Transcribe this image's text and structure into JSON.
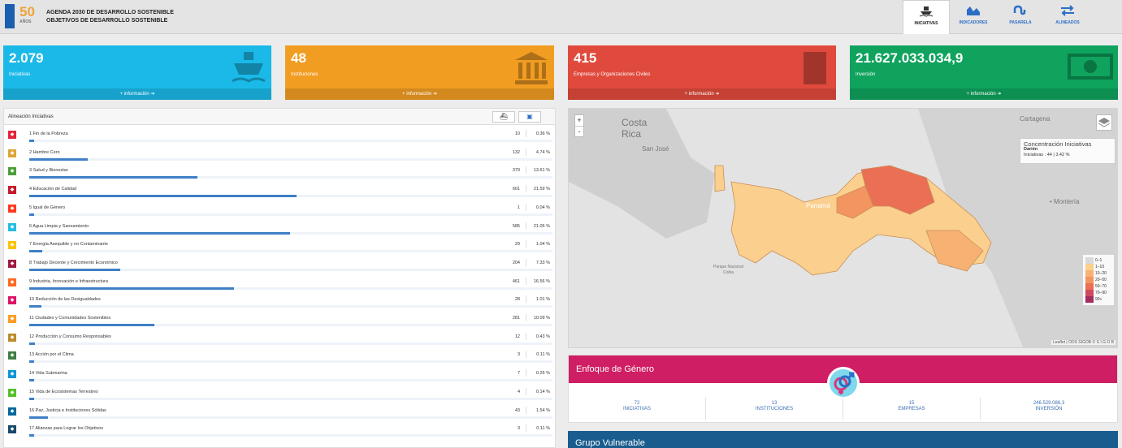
{
  "header": {
    "logo_50": "50",
    "logo_50_sub": "AÑOS",
    "title_line1": "AGENDA 2030 DE DESARROLLO SOSTENIBLE",
    "title_line2": "OBJETIVOS DE DESARROLLO SOSTENIBLE",
    "nav": [
      {
        "label": "INICIATIVAS",
        "icon": "ship-icon",
        "active": true
      },
      {
        "label": "INDICADORES",
        "icon": "area-chart-icon",
        "active": false
      },
      {
        "label": "PASARELA",
        "icon": "stumbleupon-icon",
        "active": false
      },
      {
        "label": "ALINEADOS",
        "icon": "exchange-icon",
        "active": false
      }
    ]
  },
  "cards": [
    {
      "value": "2.079",
      "label": "Iniciativas",
      "more": "+ información",
      "color": "#1ab9e8",
      "icon": "ship-icon"
    },
    {
      "value": "48",
      "label": "Instituciones",
      "more": "+ información",
      "color": "#f19d22",
      "icon": "institution-icon"
    },
    {
      "value": "415",
      "label": "Empresas y Organizaciones Civiles",
      "more": "+ información",
      "color": "#e04a3c",
      "icon": "building-icon"
    },
    {
      "value": "21.627.033.034,9",
      "label": "Inversión",
      "more": "+ información",
      "color": "#0fa35e",
      "icon": "money-icon"
    }
  ],
  "alignment": {
    "title": "Alineación Iniciativas",
    "tabs": [
      "ship-icon",
      "money-icon"
    ],
    "goals": [
      {
        "name": "1 Fin de la Pobreza",
        "count": "10",
        "pct": "0.36 %",
        "share": 0.36,
        "color": "#e5243b"
      },
      {
        "name": "2 Hambre Cero",
        "count": "132",
        "pct": "4.74 %",
        "share": 4.74,
        "color": "#dda63a"
      },
      {
        "name": "3 Salud y Bienestar",
        "count": "379",
        "pct": "13.61 %",
        "share": 13.61,
        "color": "#4c9f38"
      },
      {
        "name": "4 Educación de Calidad",
        "count": "601",
        "pct": "21.59 %",
        "share": 21.59,
        "color": "#c5192d"
      },
      {
        "name": "5 Igual de Género",
        "count": "1",
        "pct": "0.04 %",
        "share": 0.04,
        "color": "#ff3a21"
      },
      {
        "name": "6 Agua Limpia y Saneamiento",
        "count": "585",
        "pct": "21.05 %",
        "share": 21.05,
        "color": "#26bde2"
      },
      {
        "name": "7 Energía Asequible y no Contaminante",
        "count": "29",
        "pct": "1.04 %",
        "share": 1.04,
        "color": "#fcc30b"
      },
      {
        "name": "8 Trabajo Decente y Crecimiento Económico",
        "count": "204",
        "pct": "7.33 %",
        "share": 7.33,
        "color": "#a21942"
      },
      {
        "name": "9 Industria, Innovación e Infraestructura",
        "count": "461",
        "pct": "16.56 %",
        "share": 16.56,
        "color": "#fd6925"
      },
      {
        "name": "10 Reducción de las Desigualdades",
        "count": "28",
        "pct": "1.01 %",
        "share": 1.01,
        "color": "#dd1367"
      },
      {
        "name": "11 Ciudades y Comunidades Sostenibles",
        "count": "281",
        "pct": "10.09 %",
        "share": 10.09,
        "color": "#fd9d24"
      },
      {
        "name": "12 Producción y Consumo Responsables",
        "count": "12",
        "pct": "0.43 %",
        "share": 0.43,
        "color": "#bf8b2e"
      },
      {
        "name": "13 Acción por el Clima",
        "count": "3",
        "pct": "0.11 %",
        "share": 0.11,
        "color": "#3f7e44"
      },
      {
        "name": "14 Vida Submarina",
        "count": "7",
        "pct": "0.25 %",
        "share": 0.25,
        "color": "#0a97d9"
      },
      {
        "name": "15 Vida de Ecosistemas Terrestres",
        "count": "4",
        "pct": "0.14 %",
        "share": 0.14,
        "color": "#56c02b"
      },
      {
        "name": "16 Paz, Justicia e Instituciones Sólidas",
        "count": "43",
        "pct": "1.54 %",
        "share": 1.54,
        "color": "#00689d"
      },
      {
        "name": "17 Alianzas para Lograr los Objetivos",
        "count": "3",
        "pct": "0.11 %",
        "share": 0.11,
        "color": "#19486a"
      }
    ]
  },
  "map": {
    "zoom_in": "+",
    "zoom_out": "-",
    "labels": {
      "costa": "Costa",
      "rica": "Rica",
      "san_jose": "San José",
      "cartagena": "Cartagena",
      "monteria": "• Montería",
      "panama": "Panamá",
      "parque": "Parque Nacional",
      "coiba": "Coiba"
    },
    "tooltip": {
      "title": "Concentración Iniciativas",
      "region": "Darién",
      "detail": "Iniciativas : 44 | 3.42 %"
    },
    "legend": [
      {
        "label": "0–1",
        "color": "#d9d9d9"
      },
      {
        "label": "1–10",
        "color": "#fbcf8e"
      },
      {
        "label": "10–20",
        "color": "#f7b273"
      },
      {
        "label": "20–50",
        "color": "#f29560"
      },
      {
        "label": "50–70",
        "color": "#ea6f55"
      },
      {
        "label": "70–90",
        "color": "#cf4a5d"
      },
      {
        "label": "90+",
        "color": "#a32d5e"
      }
    ],
    "attribution": "Leaflet | ODS SIGOB © S I G O B"
  },
  "gender": {
    "title": "Enfoque de Género",
    "icon": "gender-icon",
    "stats": [
      {
        "value": "72",
        "label": "INICIATIVAS"
      },
      {
        "value": "13",
        "label": "INSTITUCIONES"
      },
      {
        "value": "15",
        "label": "EMPRESAS"
      },
      {
        "value": "246.529.086,3",
        "label": "INVERSIÓN"
      }
    ]
  },
  "vulnerable": {
    "title": "Grupo Vulnerable"
  }
}
